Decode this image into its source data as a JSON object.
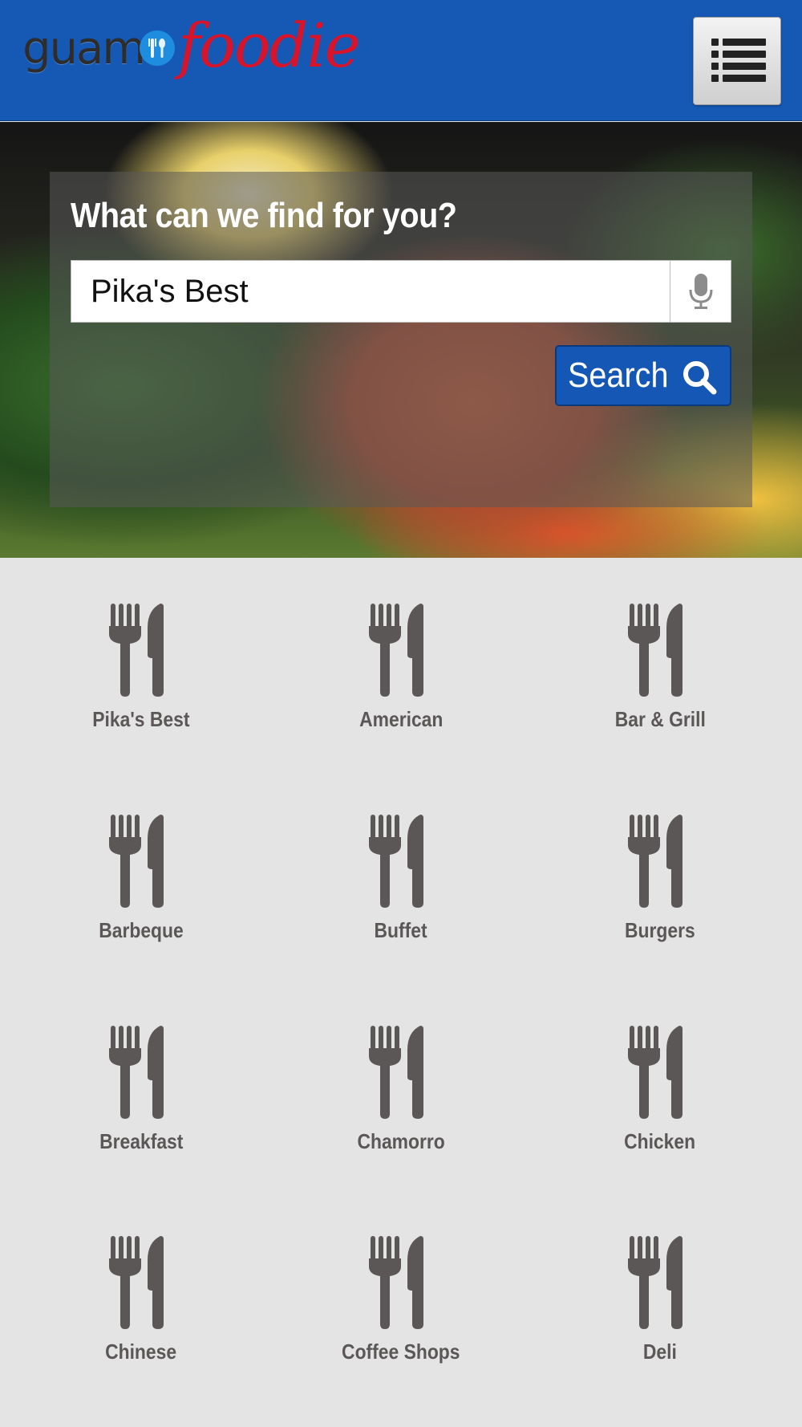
{
  "header": {
    "logo_part1": "guam",
    "logo_part2": "foodie",
    "menu_icon": "hamburger-list-icon"
  },
  "search": {
    "heading": "What can we find for you?",
    "value": "Pika's Best",
    "mic_icon": "microphone-icon",
    "button_label": "Search",
    "button_icon": "magnifier-icon"
  },
  "categories": [
    {
      "label": "Pika's Best",
      "icon": "fork-knife-icon"
    },
    {
      "label": "American",
      "icon": "fork-knife-icon"
    },
    {
      "label": "Bar & Grill",
      "icon": "fork-knife-icon"
    },
    {
      "label": "Barbeque",
      "icon": "fork-knife-icon"
    },
    {
      "label": "Buffet",
      "icon": "fork-knife-icon"
    },
    {
      "label": "Burgers",
      "icon": "fork-knife-icon"
    },
    {
      "label": "Breakfast",
      "icon": "fork-knife-icon"
    },
    {
      "label": "Chamorro",
      "icon": "fork-knife-icon"
    },
    {
      "label": "Chicken",
      "icon": "fork-knife-icon"
    },
    {
      "label": "Chinese",
      "icon": "fork-knife-icon"
    },
    {
      "label": "Coffee Shops",
      "icon": "fork-knife-icon"
    },
    {
      "label": "Deli",
      "icon": "fork-knife-icon"
    }
  ],
  "colors": {
    "header_bg": "#1559b5",
    "logo_red": "#d8142b",
    "button_blue": "#1557b4",
    "icon_gray": "#5b5757",
    "page_bg": "#e4e4e4"
  }
}
